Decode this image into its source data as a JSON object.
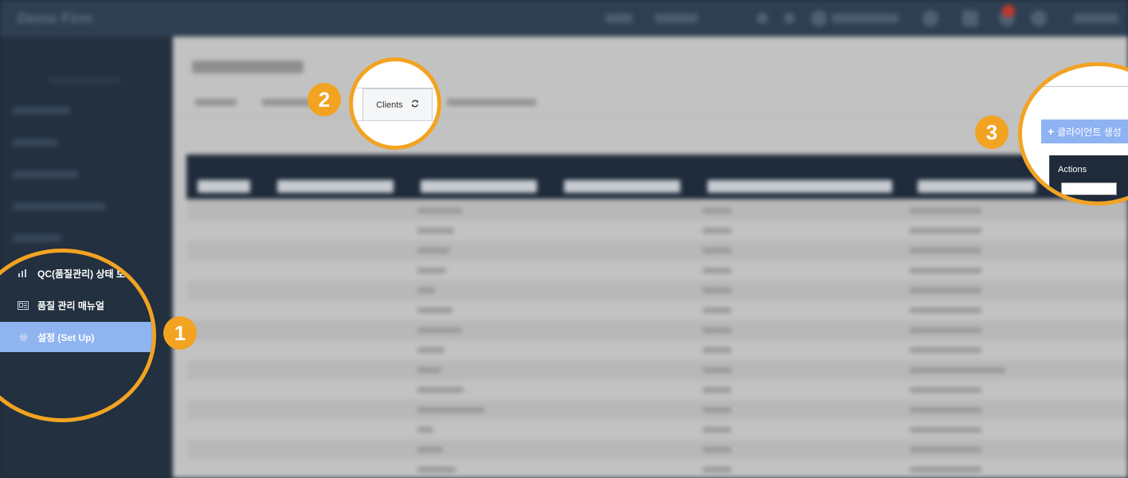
{
  "app": {
    "brand": "Demo Firm"
  },
  "sidebar": {
    "menu": [
      {
        "label": "QC(품질관리) 상태 보고",
        "icon": "chart-icon",
        "active": false
      },
      {
        "label": "품질 관리 매뉴얼",
        "icon": "manual-icon",
        "active": false
      },
      {
        "label": "설정 (Set Up)",
        "icon": "gear-icon",
        "active": true
      }
    ]
  },
  "tabs": {
    "active_label": "Clients",
    "active_icon": "refresh-icon"
  },
  "toolbar": {
    "create_client_label": "클라이언트 생성",
    "create_icon": "plus-icon"
  },
  "table": {
    "actions_header": "Actions"
  },
  "callouts": [
    "1",
    "2",
    "3"
  ],
  "colors": {
    "callout": "#f2a322",
    "active_menu": "#8fb4f0",
    "primary_button": "#8fb3f2",
    "header_bg": "#1f2b3a"
  }
}
